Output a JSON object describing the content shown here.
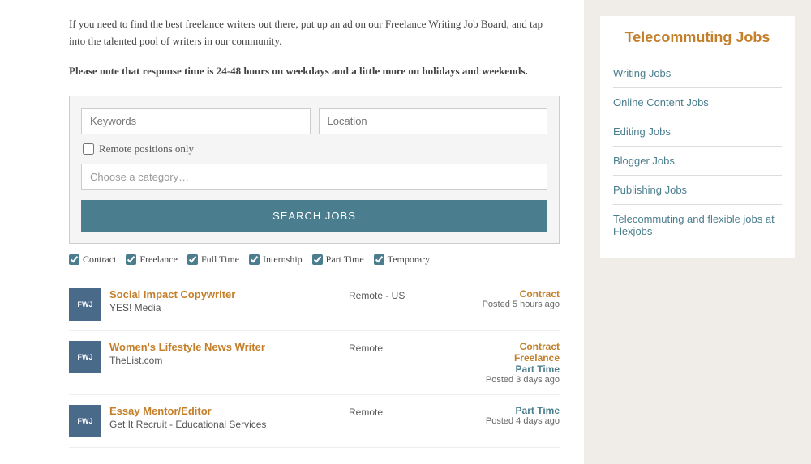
{
  "main": {
    "intro": "If you need to find the best freelance writers out there, put up an ad on our Freelance Writing Job Board, and tap into the talented pool of writers in our community.",
    "notice": "Please note that response time is 24-48 hours on weekdays and a little more on holidays and weekends.",
    "search": {
      "keywords_placeholder": "Keywords",
      "location_placeholder": "Location",
      "remote_label": "Remote positions only",
      "category_placeholder": "Choose a category…",
      "search_button": "SEARCH JOBS"
    },
    "filters": [
      {
        "label": "Contract",
        "checked": true
      },
      {
        "label": "Freelance",
        "checked": true
      },
      {
        "label": "Full Time",
        "checked": true
      },
      {
        "label": "Internship",
        "checked": true
      },
      {
        "label": "Part Time",
        "checked": true
      },
      {
        "label": "Temporary",
        "checked": true
      }
    ],
    "jobs": [
      {
        "logo": "FWJ",
        "title": "Social Impact Copywriter",
        "company": "YES! Media",
        "location": "Remote - US",
        "types": [
          {
            "label": "Contract",
            "class": "contract"
          }
        ],
        "posted": "Posted 5 hours ago"
      },
      {
        "logo": "FWJ",
        "title": "Women's Lifestyle News Writer",
        "company": "TheList.com",
        "location": "Remote",
        "types": [
          {
            "label": "Contract",
            "class": "contract"
          },
          {
            "label": "Freelance",
            "class": "freelance"
          },
          {
            "label": "Part Time",
            "class": "parttime"
          }
        ],
        "posted": "Posted 3 days ago"
      },
      {
        "logo": "FWJ",
        "title": "Essay Mentor/Editor",
        "company": "Get It Recruit - Educational Services",
        "location": "Remote",
        "types": [
          {
            "label": "Part Time",
            "class": "parttime"
          }
        ],
        "posted": "Posted 4 days ago"
      }
    ]
  },
  "sidebar": {
    "title": "Telecommuting Jobs",
    "links": [
      {
        "label": "Writing Jobs"
      },
      {
        "label": "Online Content Jobs"
      },
      {
        "label": "Editing Jobs"
      },
      {
        "label": "Blogger Jobs"
      },
      {
        "label": "Publishing Jobs"
      },
      {
        "label": "Telecommuting and flexible jobs at Flexjobs"
      }
    ]
  }
}
